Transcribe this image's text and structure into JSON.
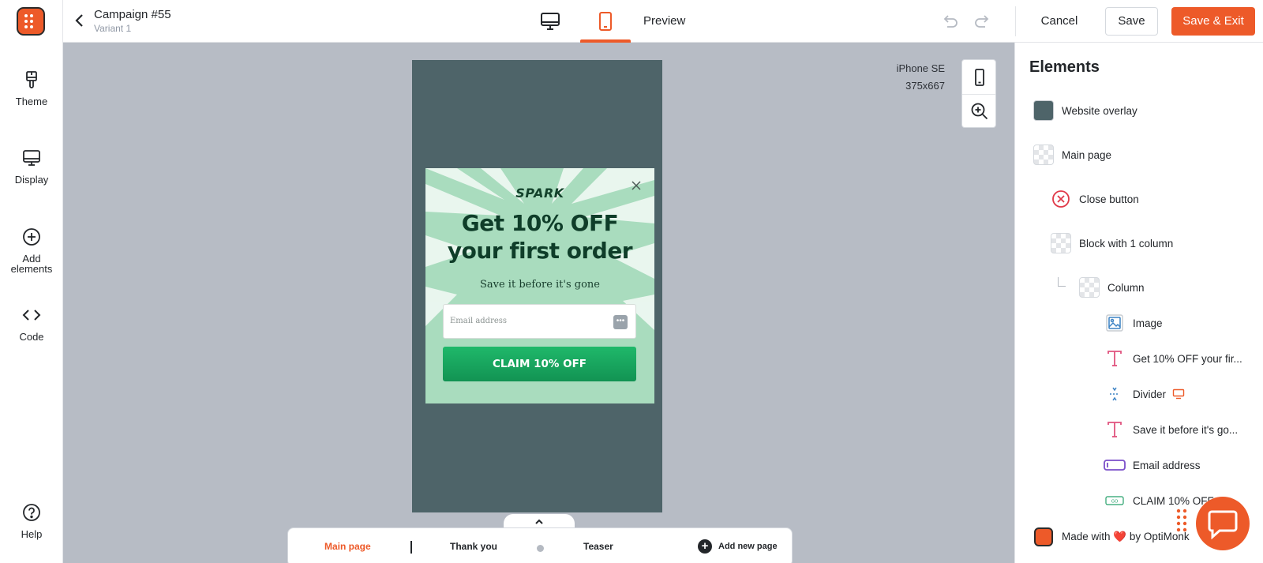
{
  "colors": {
    "accent": "#ed5a29",
    "overlay": "#4e6469",
    "popup_bg": "#a9dcbe",
    "button_green": "#1aa862"
  },
  "sidebar": {
    "items": [
      {
        "label": "Theme",
        "icon": "paintbrush-icon"
      },
      {
        "label": "Display",
        "icon": "monitor-icon"
      },
      {
        "label": "Add\nelements",
        "icon": "plus-circle-icon"
      },
      {
        "label": "Code",
        "icon": "code-icon"
      }
    ],
    "help": {
      "label": "Help",
      "icon": "help-icon"
    }
  },
  "topbar": {
    "title": "Campaign #55",
    "subtitle": "Variant 1",
    "preview_label": "Preview",
    "cancel_label": "Cancel",
    "save_label": "Save",
    "save_exit_label": "Save & Exit",
    "active_device": "mobile"
  },
  "canvas": {
    "device_name": "iPhone SE",
    "device_size": "375x667",
    "popup": {
      "brand": "SPARK",
      "headline_line1": "Get 10% OFF",
      "headline_line2": "your first order",
      "subline": "Save it before it's gone",
      "email_placeholder": "Email address",
      "button_label": "CLAIM 10% OFF"
    }
  },
  "page_tabs": {
    "items": [
      {
        "label": "Main page",
        "active": true
      },
      {
        "label": "Thank you",
        "active": false
      },
      {
        "label": "Teaser",
        "active": false
      }
    ],
    "add_label": "Add new page"
  },
  "elements_panel": {
    "title": "Elements",
    "items": [
      {
        "label": "Website overlay",
        "icon": "color-swatch-icon"
      },
      {
        "label": "Main page",
        "icon": "transparent-icon"
      },
      {
        "label": "Close button",
        "icon": "close-circle-icon"
      },
      {
        "label": "Block with 1 column",
        "icon": "transparent-icon"
      },
      {
        "label": "Column",
        "icon": "transparent-icon"
      },
      {
        "label": "Image",
        "icon": "image-icon"
      },
      {
        "label": "Get 10% OFF your fir...",
        "icon": "text-icon"
      },
      {
        "label": "Divider",
        "icon": "divider-icon"
      },
      {
        "label": "Save it before it's go...",
        "icon": "text-icon"
      },
      {
        "label": "Email address",
        "icon": "input-icon"
      },
      {
        "label": "CLAIM 10% OFF",
        "icon": "button-icon"
      },
      {
        "label": "Made with ❤️ by OptiMonk",
        "icon": "optimonk-logo-icon"
      }
    ]
  }
}
